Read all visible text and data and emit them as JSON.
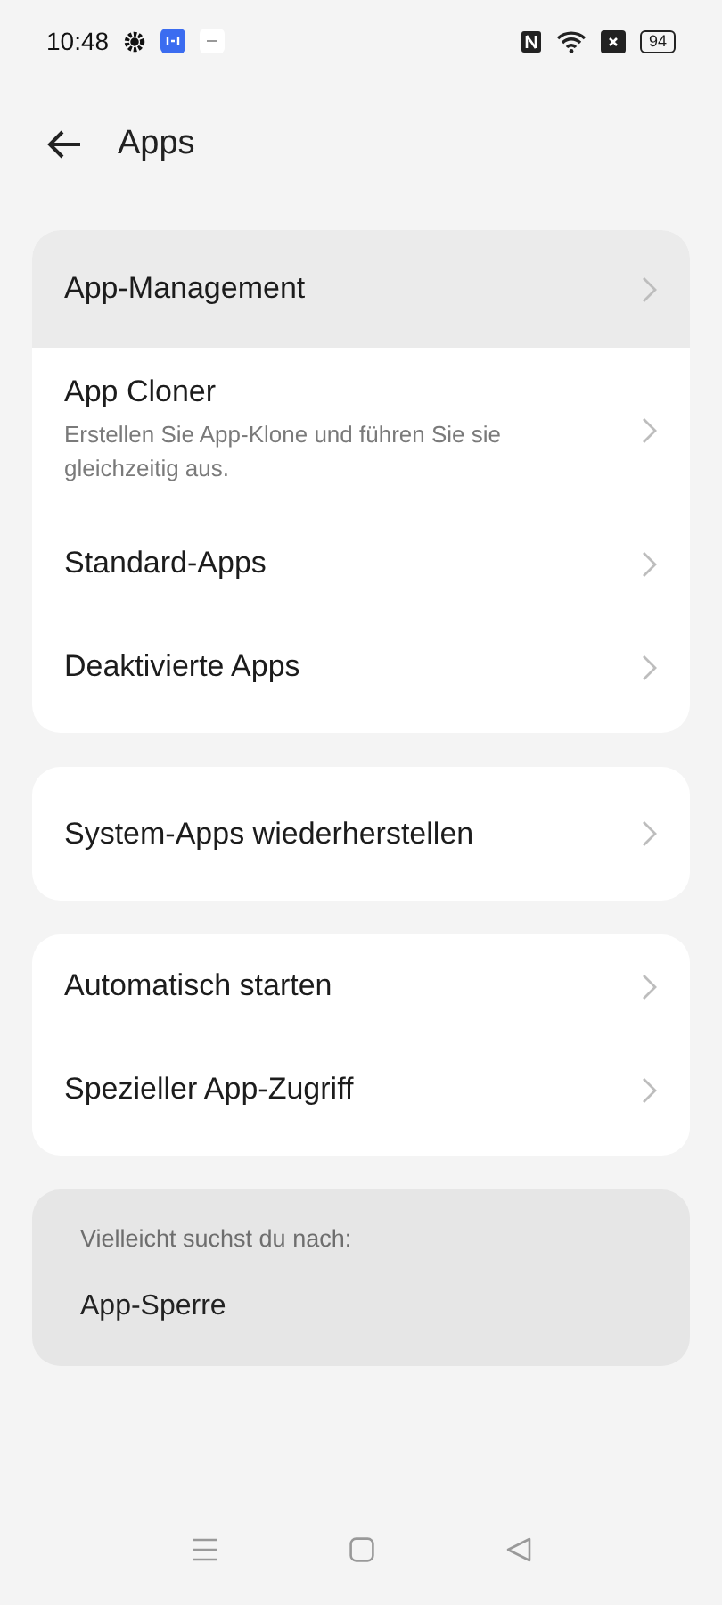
{
  "status_bar": {
    "time": "10:48",
    "battery": "94"
  },
  "header": {
    "title": "Apps"
  },
  "groups": [
    {
      "items": [
        {
          "label": "App-Management",
          "selected": true
        },
        {
          "label": "App Cloner",
          "description": "Erstellen Sie App-Klone und führen Sie sie gleichzeitig aus.",
          "selected": false
        },
        {
          "label": "Standard-Apps",
          "selected": false
        },
        {
          "label": "Deaktivierte Apps",
          "selected": false
        }
      ]
    },
    {
      "items": [
        {
          "label": "System-Apps wiederherstellen",
          "selected": false
        }
      ]
    },
    {
      "items": [
        {
          "label": "Automatisch starten",
          "selected": false
        },
        {
          "label": "Spezieller App-Zugriff",
          "selected": false
        }
      ]
    }
  ],
  "suggestion": {
    "heading": "Vielleicht suchst du nach:",
    "items": [
      "App-Sperre"
    ]
  }
}
